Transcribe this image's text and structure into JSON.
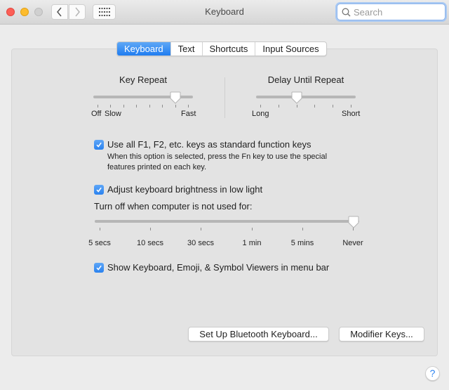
{
  "window": {
    "title": "Keyboard",
    "search_placeholder": "Search"
  },
  "tabs": [
    {
      "label": "Keyboard",
      "active": true
    },
    {
      "label": "Text",
      "active": false
    },
    {
      "label": "Shortcuts",
      "active": false
    },
    {
      "label": "Input Sources",
      "active": false
    }
  ],
  "key_repeat": {
    "title": "Key Repeat",
    "left_label": "Off",
    "left_label2": "Slow",
    "right_label": "Fast",
    "tick_count": 8,
    "value_index": 6
  },
  "delay_until_repeat": {
    "title": "Delay Until Repeat",
    "left_label": "Long",
    "right_label": "Short",
    "tick_count": 6,
    "value_index": 2
  },
  "options": {
    "fn_keys": {
      "label": "Use all F1, F2, etc. keys as standard function keys",
      "checked": true,
      "description_line1": "When this option is selected, press the Fn key to use the special",
      "description_line2": "features printed on each key."
    },
    "brightness": {
      "label": "Adjust keyboard brightness in low light",
      "checked": true
    },
    "turn_off": {
      "label": "Turn off when computer is not used for:",
      "stops": [
        "5 secs",
        "10 secs",
        "30 secs",
        "1 min",
        "5 mins",
        "Never"
      ],
      "value_index": 5
    },
    "viewers": {
      "label": "Show Keyboard, Emoji, & Symbol Viewers in menu bar",
      "checked": true
    }
  },
  "buttons": {
    "bluetooth": "Set Up Bluetooth Keyboard...",
    "modifier": "Modifier Keys...",
    "help": "?"
  },
  "colors": {
    "accent": "#1f7cf0"
  }
}
